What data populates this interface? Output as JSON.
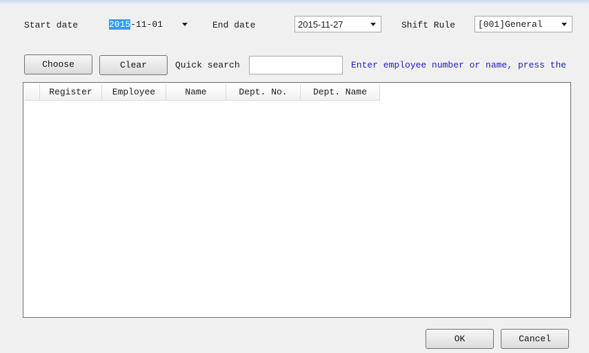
{
  "filters": {
    "start_date_label": "Start date",
    "start_date_selected": "2015",
    "start_date_rest": "-11-01",
    "end_date_label": "End date",
    "end_date_value": "2015-11-27",
    "shift_rule_label": "Shift Rule",
    "shift_rule_value": "[001]General"
  },
  "toolbar": {
    "choose_label": "Choose",
    "clear_label": "Clear",
    "quick_search_label": "Quick search",
    "quick_search_value": "",
    "hint": "Enter employee number or name, press the"
  },
  "table": {
    "columns": [
      "Register",
      "Employee",
      "Name",
      "Dept. No.",
      "Dept. Name"
    ],
    "rows": []
  },
  "footer": {
    "ok_label": "OK",
    "cancel_label": "Cancel"
  }
}
